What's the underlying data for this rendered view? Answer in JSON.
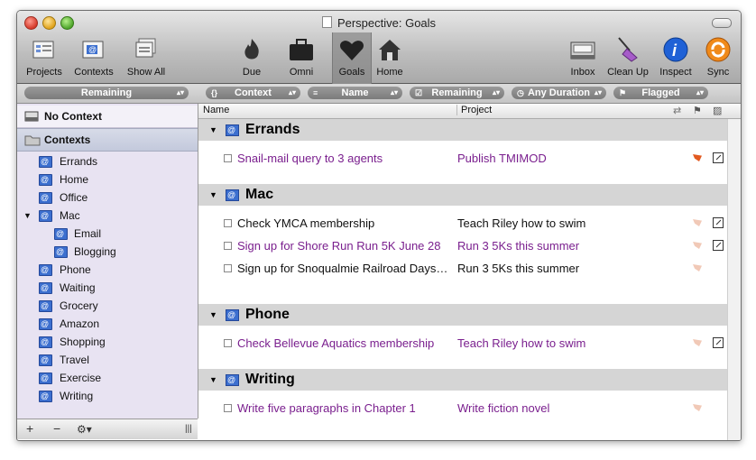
{
  "window": {
    "title": "Perspective: Goals"
  },
  "toolbar": {
    "projects": "Projects",
    "contexts": "Contexts",
    "show_all": "Show All",
    "due": "Due",
    "omni": "Omni",
    "goals": "Goals",
    "home": "Home",
    "inbox": "Inbox",
    "clean_up": "Clean Up",
    "inspect": "Inspect",
    "sync": "Sync"
  },
  "filters": {
    "remaining_left": "Remaining",
    "context": "Context",
    "name": "Name",
    "remaining": "Remaining",
    "duration": "Any Duration",
    "flagged": "Flagged"
  },
  "sidebar": {
    "no_context": "No Context",
    "contexts_header": "Contexts",
    "items": [
      {
        "label": "Errands"
      },
      {
        "label": "Home"
      },
      {
        "label": "Office"
      },
      {
        "label": "Mac"
      },
      {
        "label": "Email"
      },
      {
        "label": "Blogging"
      },
      {
        "label": "Phone"
      },
      {
        "label": "Waiting"
      },
      {
        "label": "Grocery"
      },
      {
        "label": "Amazon"
      },
      {
        "label": "Shopping"
      },
      {
        "label": "Travel"
      },
      {
        "label": "Exercise"
      },
      {
        "label": "Writing"
      }
    ],
    "add": "+",
    "remove": "−",
    "gear": "⚙▾",
    "resize": "|||"
  },
  "columns": {
    "name": "Name",
    "project": "Project"
  },
  "groups": [
    {
      "name": "Errands",
      "tasks": [
        {
          "name": "Snail-mail query to 3 agents",
          "project": "Publish TMIMOD",
          "color": "purple",
          "flag": "on",
          "note": true
        }
      ]
    },
    {
      "name": "Mac",
      "tasks": [
        {
          "name": "Check YMCA membership",
          "project": "Teach Riley how to swim",
          "color": "black",
          "flag": "off",
          "note": true
        },
        {
          "name": "Sign up for Shore Run Run 5K June 28",
          "project": "Run 3 5Ks this summer",
          "color": "purple",
          "flag": "off",
          "note": true
        },
        {
          "name": "Sign up for Snoqualmie Railroad Days…",
          "project": "Run 3 5Ks this summer",
          "color": "black",
          "flag": "off",
          "note": false
        }
      ]
    },
    {
      "name": "Phone",
      "tasks": [
        {
          "name": "Check Bellevue Aquatics membership",
          "project": "Teach Riley how to swim",
          "color": "purple",
          "flag": "off",
          "note": true
        }
      ]
    },
    {
      "name": "Writing",
      "tasks": [
        {
          "name": "Write five paragraphs in Chapter 1",
          "project": "Write fiction novel",
          "color": "purple",
          "flag": "off",
          "note": false
        }
      ]
    }
  ]
}
